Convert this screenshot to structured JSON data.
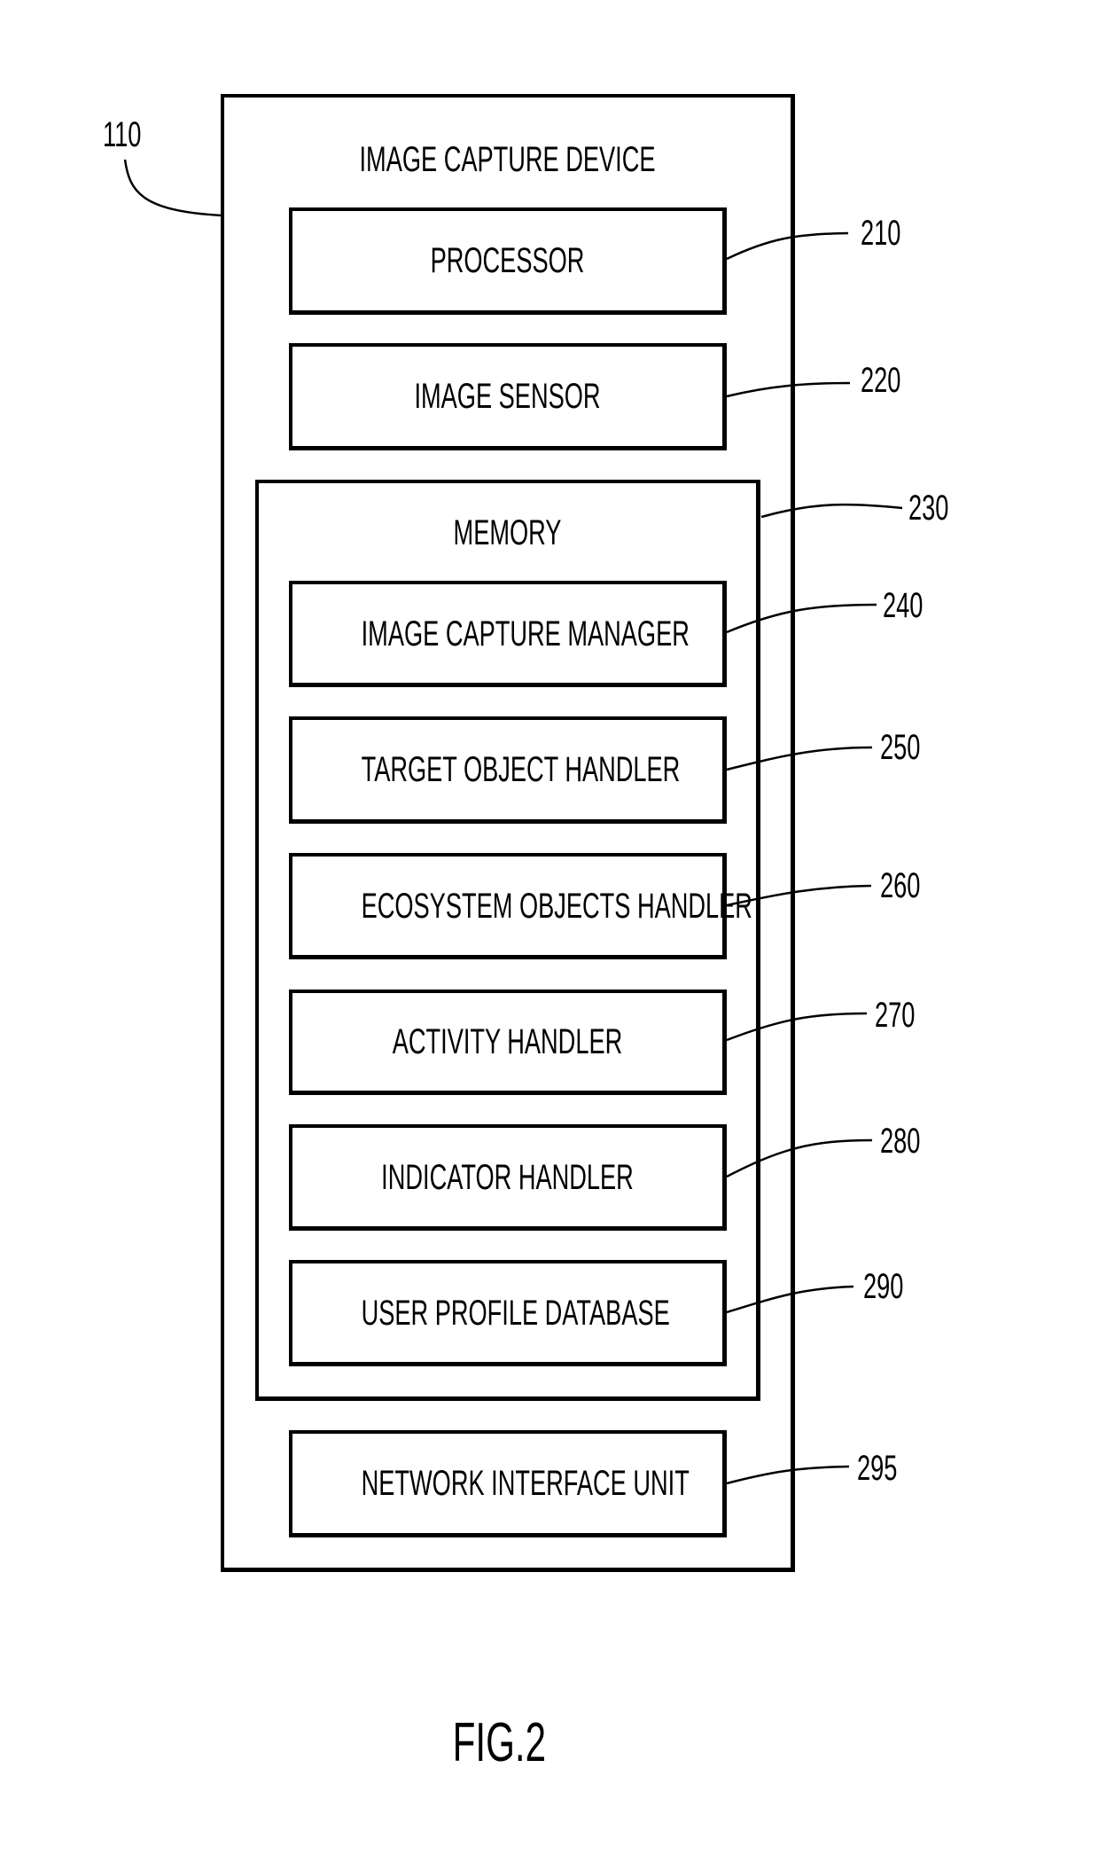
{
  "figure": {
    "caption": "FIG.2",
    "device": {
      "title": "IMAGE CAPTURE DEVICE",
      "ref": "110"
    },
    "components": [
      {
        "label": "PROCESSOR",
        "ref": "210"
      },
      {
        "label": "IMAGE SENSOR",
        "ref": "220"
      }
    ],
    "memory": {
      "title": "MEMORY",
      "ref": "230",
      "modules": [
        {
          "label": "IMAGE CAPTURE MANAGER",
          "ref": "240"
        },
        {
          "label": "TARGET OBJECT HANDLER",
          "ref": "250"
        },
        {
          "label": "ECOSYSTEM OBJECTS HANDLER",
          "ref": "260"
        },
        {
          "label": "ACTIVITY HANDLER",
          "ref": "270"
        },
        {
          "label": "INDICATOR HANDLER",
          "ref": "280"
        },
        {
          "label": "USER PROFILE DATABASE",
          "ref": "290"
        }
      ]
    },
    "network": {
      "label": "NETWORK INTERFACE UNIT",
      "ref": "295"
    }
  }
}
